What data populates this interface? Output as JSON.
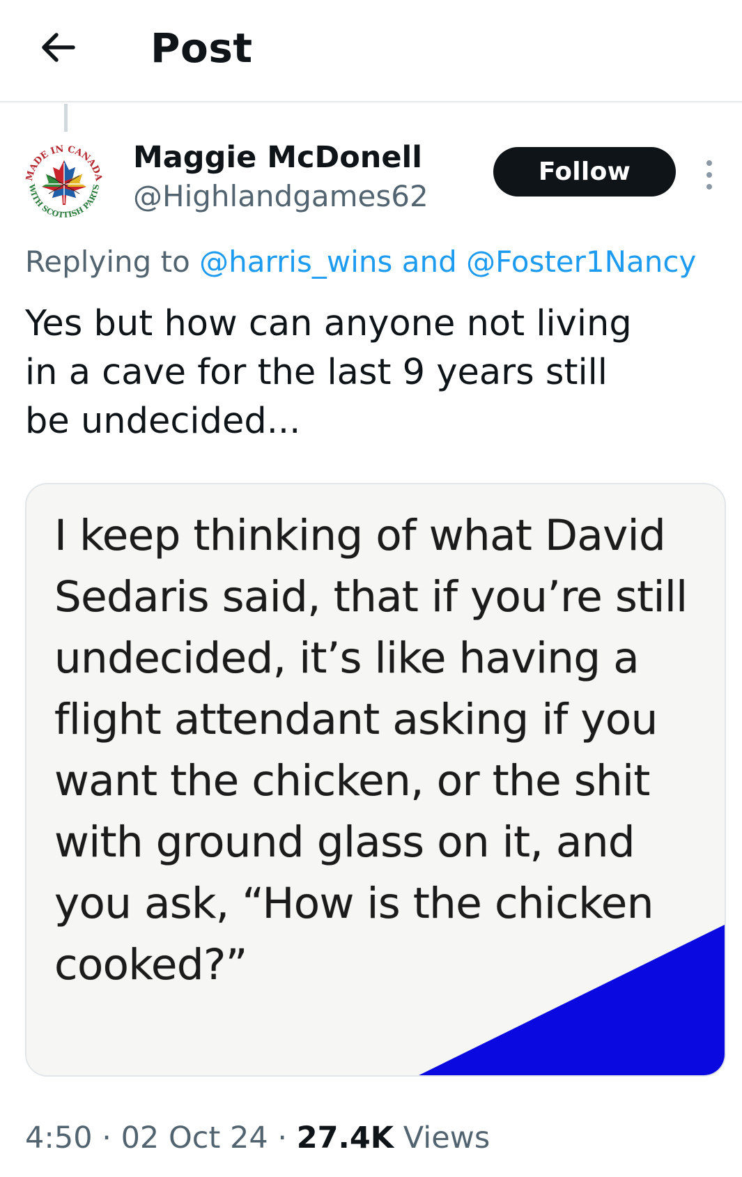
{
  "header": {
    "title": "Post",
    "back_icon": "arrow-left-icon"
  },
  "author": {
    "name": "Maggie McDonell",
    "handle": "@Highlandgames62",
    "avatar_text_top": "MADE IN CANADA",
    "avatar_text_bottom": "WITH SCOTTISH PARTS",
    "follow_label": "Follow",
    "more_icon": "more-vertical-icon"
  },
  "reply": {
    "prefix": "Replying to ",
    "mention_1": "@harris_wins",
    "joiner": " and ",
    "mention_2": "@Foster1Nancy"
  },
  "tweet": {
    "text": "Yes but how can anyone not living in a cave for the last 9 years still be undecided..."
  },
  "media": {
    "text": "I keep thinking of what David\nSedaris said, that if you’re still\nundecided, it’s like having a\nflight attendant asking if you\nwant the chicken, or the shit\nwith ground glass on it, and\nyou ask, “How is the chicken\ncooked?”",
    "corner_color": "#0a0ae0"
  },
  "meta": {
    "time": "4:50",
    "sep1": " · ",
    "date": "02 Oct 24",
    "sep2": " · ",
    "views_count": "27.4K",
    "views_label": " Views"
  },
  "colors": {
    "text": "#0f1419",
    "secondary": "#536471",
    "link": "#1d9bf0",
    "divider": "#e6e9eb"
  }
}
